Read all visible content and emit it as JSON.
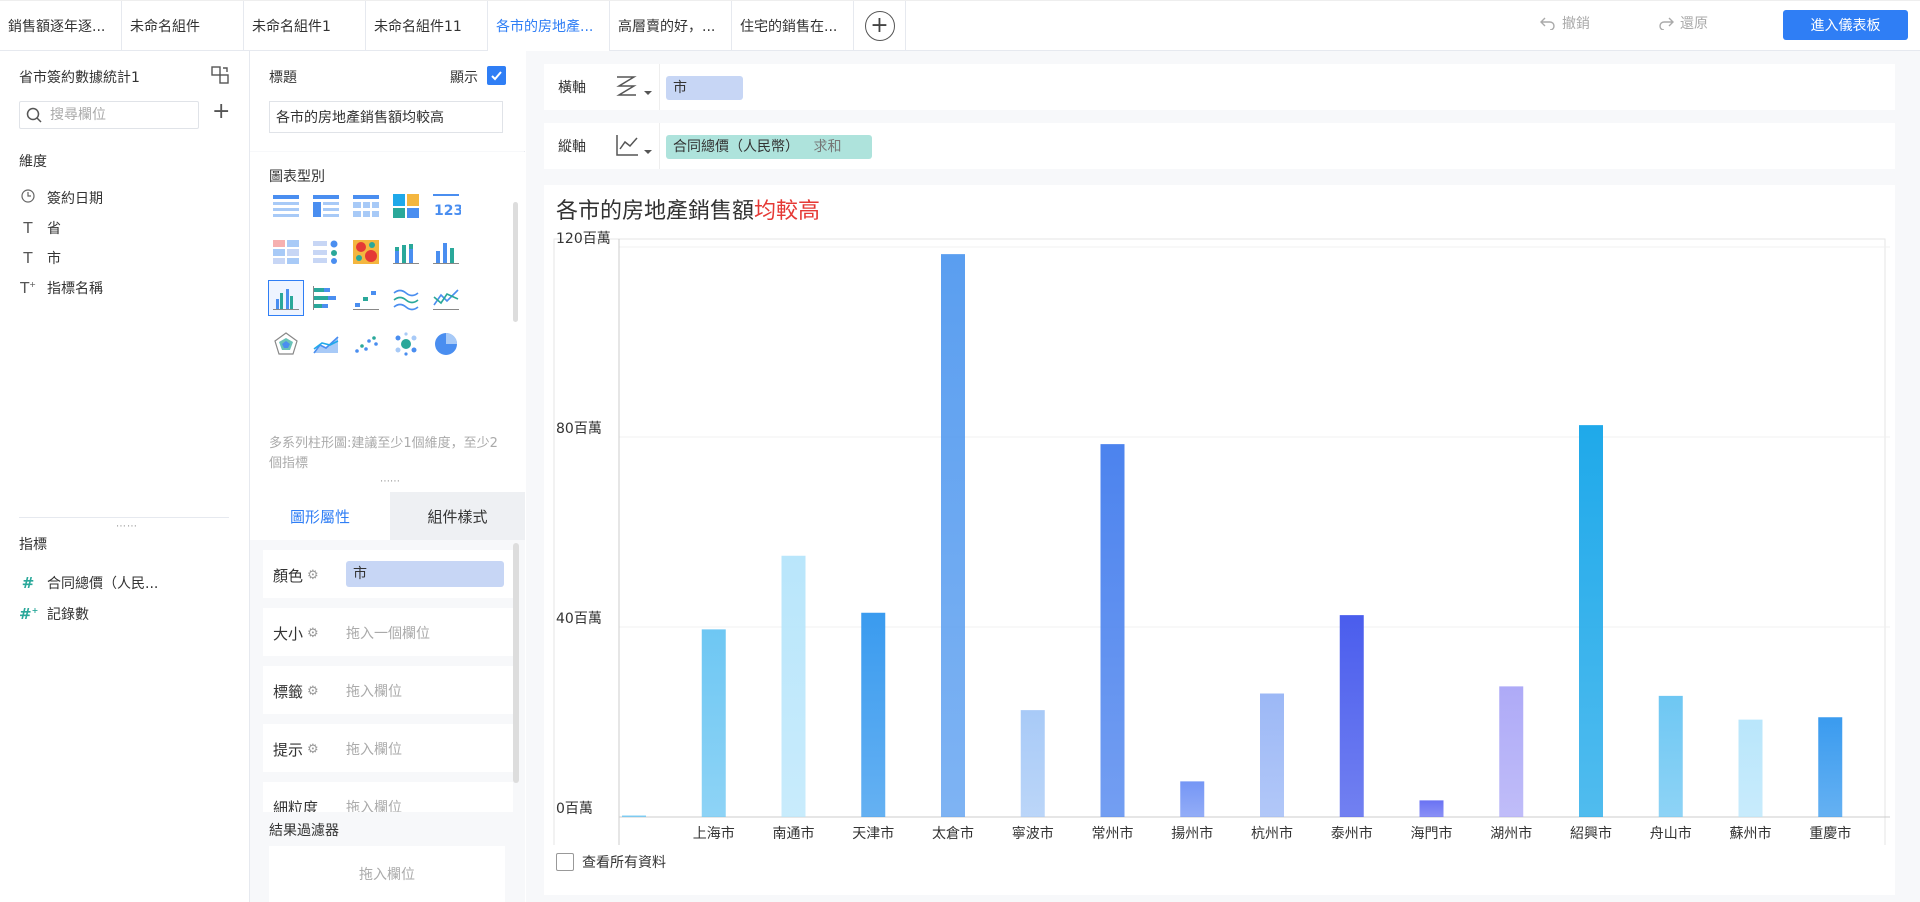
{
  "tabs": [
    {
      "label": "銷售額逐年逐..."
    },
    {
      "label": "未命名組件"
    },
    {
      "label": "未命名組件1"
    },
    {
      "label": "未命名組件11"
    },
    {
      "label": "各市的房地產..."
    },
    {
      "label": "高層賣的好，..."
    },
    {
      "label": "住宅的銷售在..."
    }
  ],
  "toolbar": {
    "undo_label": "撤銷",
    "redo_label": "還原",
    "enter_dashboard_label": "進入儀表板"
  },
  "left_panel": {
    "dataset_name": "省市簽約數據統計1",
    "search_placeholder": "搜尋欄位",
    "dimensions_title": "維度",
    "dimensions": [
      {
        "label": "簽約日期",
        "icon": "clock-icon"
      },
      {
        "label": "省",
        "icon": "text-type-icon"
      },
      {
        "label": "市",
        "icon": "text-type-icon"
      },
      {
        "label": "指標名稱",
        "icon": "text-type-icon"
      }
    ],
    "measures_title": "指標",
    "measures": [
      {
        "label": "合同總價（人民...",
        "icon": "hash-icon"
      },
      {
        "label": "記錄數",
        "icon": "hash-icon"
      }
    ]
  },
  "middle_panel": {
    "title_label": "標題",
    "show_label": "顯示",
    "title_value": "各市的房地產銷售額均較高",
    "chart_type_label": "圖表型別",
    "chart_type_hint": "多系列柱形圖:建議至少1個維度，至少2個指標",
    "tab_graph_props": "圖形屬性",
    "tab_component_style": "組件樣式",
    "props": [
      {
        "label": "顏色",
        "value": "市",
        "filled": true
      },
      {
        "label": "大小",
        "value": "拖入一個欄位",
        "filled": false
      },
      {
        "label": "標籤",
        "value": "拖入欄位",
        "filled": false
      },
      {
        "label": "提示",
        "value": "拖入欄位",
        "filled": false
      },
      {
        "label": "細粒度",
        "value": "拖入欄位",
        "filled": false
      }
    ],
    "filter_label": "結果過濾器",
    "filter_drop": "拖入欄位"
  },
  "axes": {
    "x_label": "橫軸",
    "x_field": "市",
    "y_label": "縱軸",
    "y_field": "合同總價（人民幣）",
    "y_agg": "求和"
  },
  "chart_title_main": "各市的房地產銷售額",
  "chart_title_highlight": "均較高",
  "view_all_label": "查看所有資料",
  "chart_data": {
    "type": "bar",
    "title": "各市的房地產銷售額均較高",
    "categories": [
      "",
      "上海市",
      "南通市",
      "天津市",
      "太倉市",
      "寧波市",
      "常州市",
      "揚州市",
      "杭州市",
      "泰州市",
      "海門市",
      "湖州市",
      "紹興市",
      "舟山市",
      "蘇州市",
      "重慶市"
    ],
    "values": [
      0.3,
      39.5,
      55,
      43,
      118.5,
      22.5,
      78.5,
      7.5,
      26,
      42.5,
      3.5,
      27.5,
      82.5,
      25.5,
      20.5,
      21
    ],
    "colors": [
      "#6ec7f3",
      "#6ec7f3",
      "#b9e6fb",
      "#3a9bef",
      "#5a9ef0",
      "#a8caf7",
      "#4c83ee",
      "#7596f5",
      "#9cb8f6",
      "#4a5ded",
      "#6a72f3",
      "#aeaaf7",
      "#1fa9ea",
      "#6ec7f3",
      "#b9e6fb",
      "#3a9bef"
    ],
    "ylim": [
      0,
      120
    ],
    "yticks": [
      0,
      40,
      80,
      120
    ],
    "ytick_labels": [
      "0百萬",
      "40百萬",
      "80百萬",
      "120百萬"
    ],
    "grid": true
  }
}
